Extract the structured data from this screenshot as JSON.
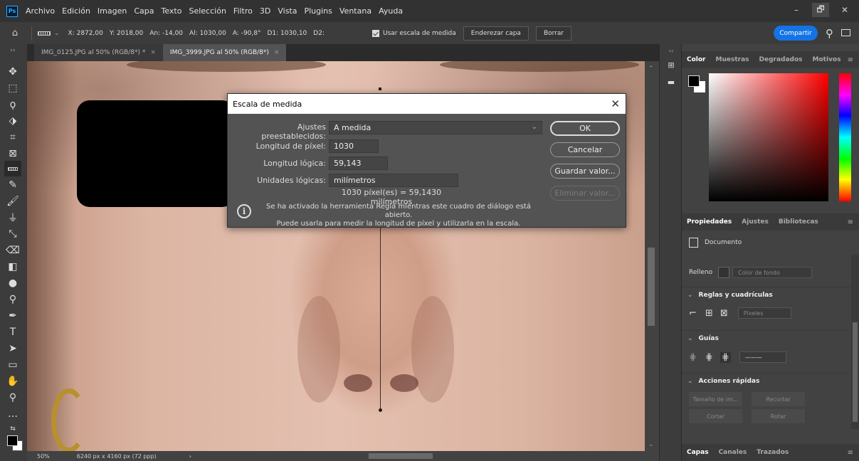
{
  "app": {
    "logo": "Ps",
    "menu": [
      "Archivo",
      "Edición",
      "Imagen",
      "Capa",
      "Texto",
      "Selección",
      "Filtro",
      "3D",
      "Vista",
      "Plugins",
      "Ventana",
      "Ayuda"
    ],
    "window_controls": {
      "minimize": "–",
      "restore": "🗗",
      "close": "✕"
    }
  },
  "options_bar": {
    "home_icon": "⌂",
    "x": "X: 2872,00",
    "y": "Y: 2018,00",
    "an": "An: -14,00",
    "al": "Al: 1030,00",
    "a": "A: -90,8°",
    "d1": "D1: 1030,10",
    "d2": "D2:",
    "use_scale_label": "Usar escala de medida",
    "straighten_label": "Enderezar capa",
    "clear_label": "Borrar",
    "share_label": "Compartir"
  },
  "tabs": [
    {
      "label": "IMG_0125.JPG al 50% (RGB/8*) *",
      "close": "×"
    },
    {
      "label": "IMG_3999.JPG al 50% (RGB/8*)",
      "close": "×"
    }
  ],
  "status_bar": {
    "zoom": "50%",
    "doc_info": "6240 px x 4160 px (72 ppp)",
    "arrow": "›"
  },
  "dialog": {
    "title": "Escala de medida",
    "close": "✕",
    "preset_label": "Ajustes preestablecidos:",
    "preset_value": "A medida",
    "pixel_length_label": "Longitud de píxel:",
    "pixel_length_value": "1030",
    "logical_length_label": "Longitud lógica:",
    "logical_length_value": "59,143",
    "logical_units_label": "Unidades lógicas:",
    "logical_units_value": "milímetros",
    "result": "1030 píxel(es) = 59,1430 milímetros",
    "info_line1": "Se ha activado la herramienta Regla mientras este cuadro de diálogo está abierto.",
    "info_line2": "Puede usarla para medir la longitud de píxel y utilizarla en la escala.",
    "buttons": {
      "ok": "OK",
      "cancel": "Cancelar",
      "save": "Guardar valor...",
      "delete": "Eliminar valor..."
    }
  },
  "color_panel": {
    "tabs": [
      "Color",
      "Muestras",
      "Degradados",
      "Motivos"
    ],
    "menu": "≡"
  },
  "properties_panel": {
    "tabs": [
      "Propiedades",
      "Ajustes",
      "Bibliotecas"
    ],
    "document_label": "Documento",
    "fill_label": "Relleno",
    "fill_value": "Color de fondo",
    "rulers_section": "Reglas y cuadrículas",
    "units_value": "Píxeles",
    "guides_section": "Guías",
    "quick_actions_section": "Acciones rápidas",
    "actions": [
      "Tamaño de im...",
      "Recortar",
      "Cortar",
      "Rotar"
    ]
  },
  "layers_panel": {
    "tabs": [
      "Capas",
      "Canales",
      "Trazados"
    ]
  },
  "colors": {
    "share_blue": "#1473e6",
    "foreground": "#000000",
    "background": "#ffffff"
  }
}
